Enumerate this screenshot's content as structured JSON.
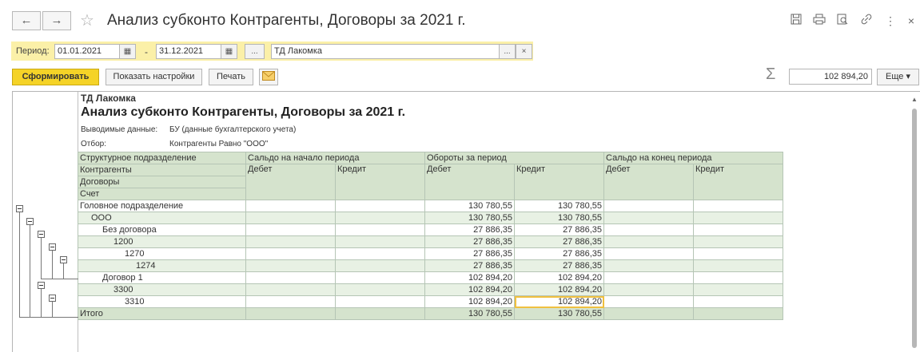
{
  "window": {
    "title": "Анализ субконто Контрагенты, Договоры  за 2021 г.",
    "back_icon": "←",
    "forward_icon": "→"
  },
  "period": {
    "label": "Период:",
    "from": "01.01.2021",
    "to": "31.12.2021",
    "dash": "-",
    "more_label": "...",
    "org_value": "ТД Лакомка",
    "org_select_label": "...",
    "org_clear_label": "×"
  },
  "toolbar": {
    "generate_label": "Сформировать",
    "settings_label": "Показать настройки",
    "print_label": "Печать",
    "sum_value": "102 894,20",
    "more_label": "Еще ▾"
  },
  "report": {
    "org": "ТД Лакомка",
    "title": "Анализ субконто Контрагенты, Договоры  за 2021 г.",
    "output_label": "Выводимые данные:",
    "output_value": "БУ (данные бухгалтерского учета)",
    "filter_label": "Отбор:",
    "filter_value": "Контрагенты Равно \"ООО\"",
    "headers": {
      "dim1": "Структурное подразделение",
      "dim2": "Контрагенты",
      "dim3": "Договоры",
      "dim4": "Счет",
      "open": "Сальдо на начало периода",
      "turnover": "Обороты за период",
      "close": "Сальдо на конец периода",
      "debit": "Дебет",
      "credit": "Кредит"
    },
    "rows": [
      {
        "name": "Головное подразделение",
        "indent": 0,
        "od": "",
        "oc": "",
        "td": "130 780,55",
        "tc": "130 780,55",
        "cd": "",
        "cc": ""
      },
      {
        "name": "ООО",
        "indent": 1,
        "od": "",
        "oc": "",
        "td": "130 780,55",
        "tc": "130 780,55",
        "cd": "",
        "cc": ""
      },
      {
        "name": "Без договора",
        "indent": 2,
        "od": "",
        "oc": "",
        "td": "27 886,35",
        "tc": "27 886,35",
        "cd": "",
        "cc": ""
      },
      {
        "name": "1200",
        "indent": 3,
        "od": "",
        "oc": "",
        "td": "27 886,35",
        "tc": "27 886,35",
        "cd": "",
        "cc": ""
      },
      {
        "name": "1270",
        "indent": 4,
        "od": "",
        "oc": "",
        "td": "27 886,35",
        "tc": "27 886,35",
        "cd": "",
        "cc": ""
      },
      {
        "name": "1274",
        "indent": 5,
        "od": "",
        "oc": "",
        "td": "27 886,35",
        "tc": "27 886,35",
        "cd": "",
        "cc": ""
      },
      {
        "name": "Договор 1",
        "indent": 2,
        "od": "",
        "oc": "",
        "td": "102 894,20",
        "tc": "102 894,20",
        "cd": "",
        "cc": ""
      },
      {
        "name": "3300",
        "indent": 3,
        "od": "",
        "oc": "",
        "td": "102 894,20",
        "tc": "102 894,20",
        "cd": "",
        "cc": ""
      },
      {
        "name": "3310",
        "indent": 4,
        "od": "",
        "oc": "",
        "td": "102 894,20",
        "tc": "102 894,20",
        "cd": "",
        "cc": ""
      }
    ],
    "total": {
      "name": "Итого",
      "td": "130 780,55",
      "tc": "130 780,55"
    }
  }
}
